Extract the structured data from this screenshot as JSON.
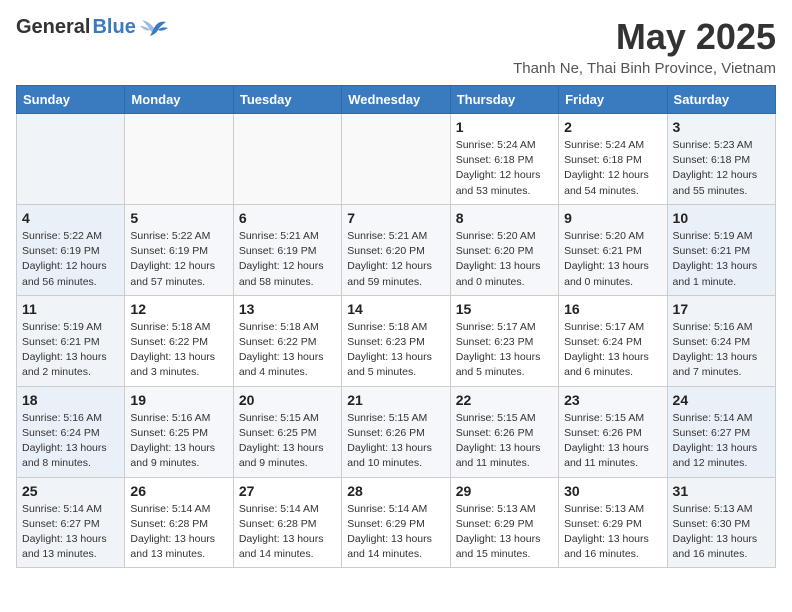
{
  "header": {
    "logo_general": "General",
    "logo_blue": "Blue",
    "month_title": "May 2025",
    "location": "Thanh Ne, Thai Binh Province, Vietnam"
  },
  "days_of_week": [
    "Sunday",
    "Monday",
    "Tuesday",
    "Wednesday",
    "Thursday",
    "Friday",
    "Saturday"
  ],
  "weeks": [
    [
      {
        "day": "",
        "info": ""
      },
      {
        "day": "",
        "info": ""
      },
      {
        "day": "",
        "info": ""
      },
      {
        "day": "",
        "info": ""
      },
      {
        "day": "1",
        "info": "Sunrise: 5:24 AM\nSunset: 6:18 PM\nDaylight: 12 hours\nand 53 minutes."
      },
      {
        "day": "2",
        "info": "Sunrise: 5:24 AM\nSunset: 6:18 PM\nDaylight: 12 hours\nand 54 minutes."
      },
      {
        "day": "3",
        "info": "Sunrise: 5:23 AM\nSunset: 6:18 PM\nDaylight: 12 hours\nand 55 minutes."
      }
    ],
    [
      {
        "day": "4",
        "info": "Sunrise: 5:22 AM\nSunset: 6:19 PM\nDaylight: 12 hours\nand 56 minutes."
      },
      {
        "day": "5",
        "info": "Sunrise: 5:22 AM\nSunset: 6:19 PM\nDaylight: 12 hours\nand 57 minutes."
      },
      {
        "day": "6",
        "info": "Sunrise: 5:21 AM\nSunset: 6:19 PM\nDaylight: 12 hours\nand 58 minutes."
      },
      {
        "day": "7",
        "info": "Sunrise: 5:21 AM\nSunset: 6:20 PM\nDaylight: 12 hours\nand 59 minutes."
      },
      {
        "day": "8",
        "info": "Sunrise: 5:20 AM\nSunset: 6:20 PM\nDaylight: 13 hours\nand 0 minutes."
      },
      {
        "day": "9",
        "info": "Sunrise: 5:20 AM\nSunset: 6:21 PM\nDaylight: 13 hours\nand 0 minutes."
      },
      {
        "day": "10",
        "info": "Sunrise: 5:19 AM\nSunset: 6:21 PM\nDaylight: 13 hours\nand 1 minute."
      }
    ],
    [
      {
        "day": "11",
        "info": "Sunrise: 5:19 AM\nSunset: 6:21 PM\nDaylight: 13 hours\nand 2 minutes."
      },
      {
        "day": "12",
        "info": "Sunrise: 5:18 AM\nSunset: 6:22 PM\nDaylight: 13 hours\nand 3 minutes."
      },
      {
        "day": "13",
        "info": "Sunrise: 5:18 AM\nSunset: 6:22 PM\nDaylight: 13 hours\nand 4 minutes."
      },
      {
        "day": "14",
        "info": "Sunrise: 5:18 AM\nSunset: 6:23 PM\nDaylight: 13 hours\nand 5 minutes."
      },
      {
        "day": "15",
        "info": "Sunrise: 5:17 AM\nSunset: 6:23 PM\nDaylight: 13 hours\nand 5 minutes."
      },
      {
        "day": "16",
        "info": "Sunrise: 5:17 AM\nSunset: 6:24 PM\nDaylight: 13 hours\nand 6 minutes."
      },
      {
        "day": "17",
        "info": "Sunrise: 5:16 AM\nSunset: 6:24 PM\nDaylight: 13 hours\nand 7 minutes."
      }
    ],
    [
      {
        "day": "18",
        "info": "Sunrise: 5:16 AM\nSunset: 6:24 PM\nDaylight: 13 hours\nand 8 minutes."
      },
      {
        "day": "19",
        "info": "Sunrise: 5:16 AM\nSunset: 6:25 PM\nDaylight: 13 hours\nand 9 minutes."
      },
      {
        "day": "20",
        "info": "Sunrise: 5:15 AM\nSunset: 6:25 PM\nDaylight: 13 hours\nand 9 minutes."
      },
      {
        "day": "21",
        "info": "Sunrise: 5:15 AM\nSunset: 6:26 PM\nDaylight: 13 hours\nand 10 minutes."
      },
      {
        "day": "22",
        "info": "Sunrise: 5:15 AM\nSunset: 6:26 PM\nDaylight: 13 hours\nand 11 minutes."
      },
      {
        "day": "23",
        "info": "Sunrise: 5:15 AM\nSunset: 6:26 PM\nDaylight: 13 hours\nand 11 minutes."
      },
      {
        "day": "24",
        "info": "Sunrise: 5:14 AM\nSunset: 6:27 PM\nDaylight: 13 hours\nand 12 minutes."
      }
    ],
    [
      {
        "day": "25",
        "info": "Sunrise: 5:14 AM\nSunset: 6:27 PM\nDaylight: 13 hours\nand 13 minutes."
      },
      {
        "day": "26",
        "info": "Sunrise: 5:14 AM\nSunset: 6:28 PM\nDaylight: 13 hours\nand 13 minutes."
      },
      {
        "day": "27",
        "info": "Sunrise: 5:14 AM\nSunset: 6:28 PM\nDaylight: 13 hours\nand 14 minutes."
      },
      {
        "day": "28",
        "info": "Sunrise: 5:14 AM\nSunset: 6:29 PM\nDaylight: 13 hours\nand 14 minutes."
      },
      {
        "day": "29",
        "info": "Sunrise: 5:13 AM\nSunset: 6:29 PM\nDaylight: 13 hours\nand 15 minutes."
      },
      {
        "day": "30",
        "info": "Sunrise: 5:13 AM\nSunset: 6:29 PM\nDaylight: 13 hours\nand 16 minutes."
      },
      {
        "day": "31",
        "info": "Sunrise: 5:13 AM\nSunset: 6:30 PM\nDaylight: 13 hours\nand 16 minutes."
      }
    ]
  ]
}
